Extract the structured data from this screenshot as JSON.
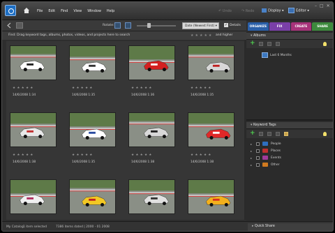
{
  "menubar": {
    "items": [
      "File",
      "Edit",
      "Find",
      "View",
      "Window",
      "Help"
    ],
    "undo": "Undo",
    "redo": "Redo",
    "display": "Display",
    "editor": "Editor"
  },
  "toolbar": {
    "rotate": "Rotate:",
    "sort": "Date (Newest First)",
    "details": "Details"
  },
  "tabs": [
    {
      "label": "ORGANIZE",
      "color": "#2a5fa8"
    },
    {
      "label": "FIX",
      "color": "#7a3fa8"
    },
    {
      "label": "CREATE",
      "color": "#a8337a"
    },
    {
      "label": "SHARE",
      "color": "#3d8a3d"
    }
  ],
  "findbar": {
    "text": "Find: Drag keyword tags, albums, photos, videos, and projects here to search",
    "stars": "★★★★★",
    "qualifier": "and higher"
  },
  "grid": {
    "stars": "★★★★★",
    "rows": [
      [
        "14/6/2008 1:34",
        "14/6/2008 1:35",
        "14/6/2008 1:36",
        "14/6/2008 1:35"
      ],
      [
        "14/6/2008 1:38",
        "14/6/2008 1:35",
        "14/6/2008 1:38",
        "14/6/2008 1:38"
      ],
      [
        "",
        "",
        "",
        ""
      ]
    ]
  },
  "panels": {
    "albums": {
      "title": "Albums",
      "item": "Last 6 Months"
    },
    "keywords": {
      "title": "Keyword Tags",
      "items": [
        {
          "label": "People",
          "color": "#2f6fc0"
        },
        {
          "label": "Places",
          "color": "#c03030"
        },
        {
          "label": "Events",
          "color": "#a03a9a"
        },
        {
          "label": "Other",
          "color": "#d07a20"
        }
      ]
    },
    "quick_share": "Quick Share"
  },
  "statusbar": {
    "catalog": "My Catalog",
    "selected": "1 item selected",
    "dated": "7386 items dated | 2000 - 01 2008"
  }
}
